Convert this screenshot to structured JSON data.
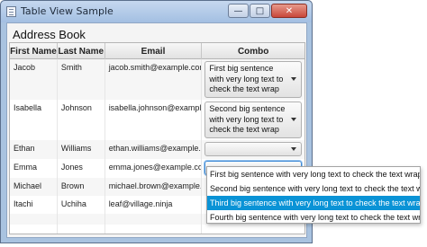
{
  "window": {
    "title": "Table View Sample",
    "minimize_glyph": "—",
    "maximize_glyph": "□",
    "close_glyph": "✕"
  },
  "app": {
    "heading": "Address Book"
  },
  "table": {
    "columns": [
      "First Name",
      "Last Name",
      "Email",
      "Combo"
    ],
    "rows": [
      {
        "first": "Jacob",
        "last": "Smith",
        "email": "jacob.smith@example.com",
        "combo": "First big sentence with very long text to check the text wrap"
      },
      {
        "first": "Isabella",
        "last": "Johnson",
        "email": "isabella.johnson@example....",
        "combo": "Second big sentence with very long text to check the text wrap"
      },
      {
        "first": "Ethan",
        "last": "Williams",
        "email": "ethan.williams@example.c...",
        "combo": ""
      },
      {
        "first": "Emma",
        "last": "Jones",
        "email": "emma.jones@example.com",
        "combo": ""
      },
      {
        "first": "Michael",
        "last": "Brown",
        "email": "michael.brown@example.c...",
        "combo": ""
      },
      {
        "first": "Itachi",
        "last": "Uchiha",
        "email": "leaf@village.ninja",
        "combo": ""
      }
    ]
  },
  "dropdown": {
    "options": [
      "First big sentence with very long text to check the text wrap",
      "Second big sentence with very long text to check the text wrap",
      "Third big sentence with very long text to check the text wrap",
      "Fourth big sentence with very long text to check the text wrap"
    ],
    "highlighted_index": 2
  },
  "colors": {
    "selection": "#0a93d6",
    "window_frame": "#a9c3e0",
    "close_button": "#c9473a"
  }
}
